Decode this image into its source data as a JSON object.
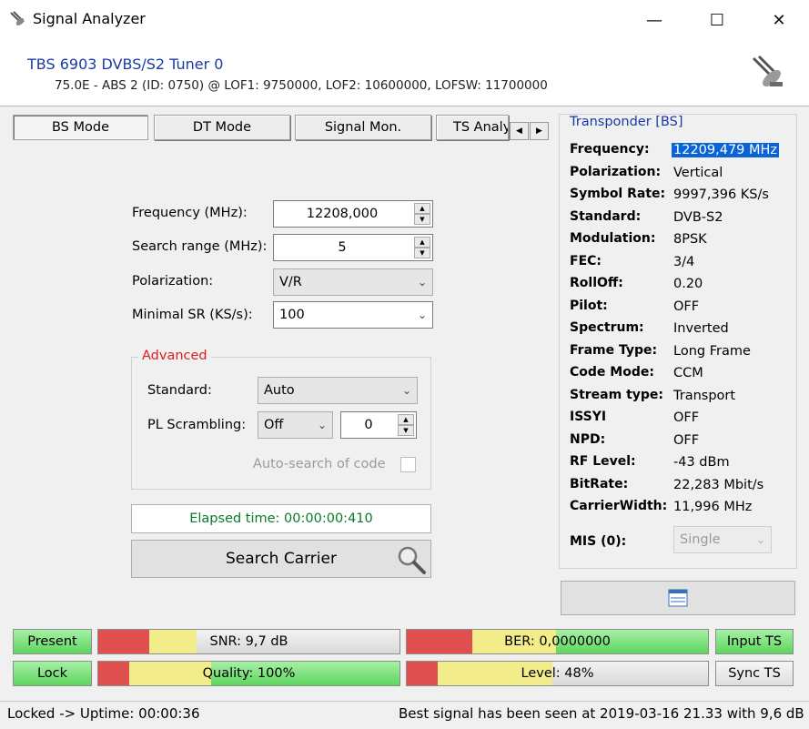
{
  "window": {
    "title": "Signal Analyzer",
    "minimize": "—",
    "maximize": "☐",
    "close": "✕"
  },
  "header": {
    "tuner": "TBS 6903 DVBS/S2 Tuner 0",
    "satellite_info": "75.0E - ABS 2 (ID: 0750) @ LOF1: 9750000, LOF2: 10600000, LOFSW: 11700000"
  },
  "tabs": [
    {
      "label": "BS Mode",
      "active": true
    },
    {
      "label": "DT Mode",
      "active": false
    },
    {
      "label": "Signal Mon.",
      "active": false
    },
    {
      "label": "TS Analy",
      "active": false
    }
  ],
  "form": {
    "frequency_label": "Frequency (MHz):",
    "frequency_value": "12208,000",
    "search_range_label": "Search range (MHz):",
    "search_range_value": "5",
    "polarization_label": "Polarization:",
    "polarization_value": "V/R",
    "minimal_sr_label": "Minimal SR (KS/s):",
    "minimal_sr_value": "100"
  },
  "advanced": {
    "legend": "Advanced",
    "standard_label": "Standard:",
    "standard_value": "Auto",
    "pl_scrambling_label": "PL Scrambling:",
    "pl_scrambling_value": "Off",
    "pl_code_value": "0",
    "auto_search_label": "Auto-search of code"
  },
  "elapsed": "Elapsed time: 00:00:00:410",
  "search_button": "Search Carrier",
  "transponder": {
    "legend": "Transponder [BS]",
    "rows": [
      {
        "key": "Frequency:",
        "value": "12209,479 MHz"
      },
      {
        "key": "Polarization:",
        "value": "Vertical"
      },
      {
        "key": "Symbol Rate:",
        "value": "9997,396 KS/s"
      },
      {
        "key": "Standard:",
        "value": "DVB-S2"
      },
      {
        "key": "Modulation:",
        "value": "8PSK"
      },
      {
        "key": "FEC:",
        "value": "3/4"
      },
      {
        "key": "RollOff:",
        "value": "0.20"
      },
      {
        "key": "Pilot:",
        "value": "OFF"
      },
      {
        "key": "Spectrum:",
        "value": "Inverted"
      },
      {
        "key": "Frame Type:",
        "value": "Long Frame"
      },
      {
        "key": "Code Mode:",
        "value": "CCM"
      },
      {
        "key": "Stream type:",
        "value": "Transport"
      },
      {
        "key": "ISSYI",
        "value": "OFF"
      },
      {
        "key": "NPD:",
        "value": "OFF"
      },
      {
        "key": "RF Level:",
        "value": "-43 dBm"
      },
      {
        "key": "BitRate:",
        "value": "22,283 Mbit/s"
      },
      {
        "key": "CarrierWidth:",
        "value": "11,996 MHz"
      }
    ],
    "mis_label": "MIS (0):",
    "mis_value": "Single"
  },
  "indicators": {
    "present": "Present",
    "lock": "Lock",
    "input_ts": "Input TS",
    "sync_ts": "Sync TS",
    "snr": "SNR: 9,7 dB",
    "ber": "BER: 0,0000000",
    "quality": "Quality: 100%",
    "level": "Level: 48%"
  },
  "status": {
    "left": "Locked -> Uptime: 00:00:36",
    "right": "Best signal has been seen at 2019-03-16 21.33 with 9,6 dB"
  }
}
